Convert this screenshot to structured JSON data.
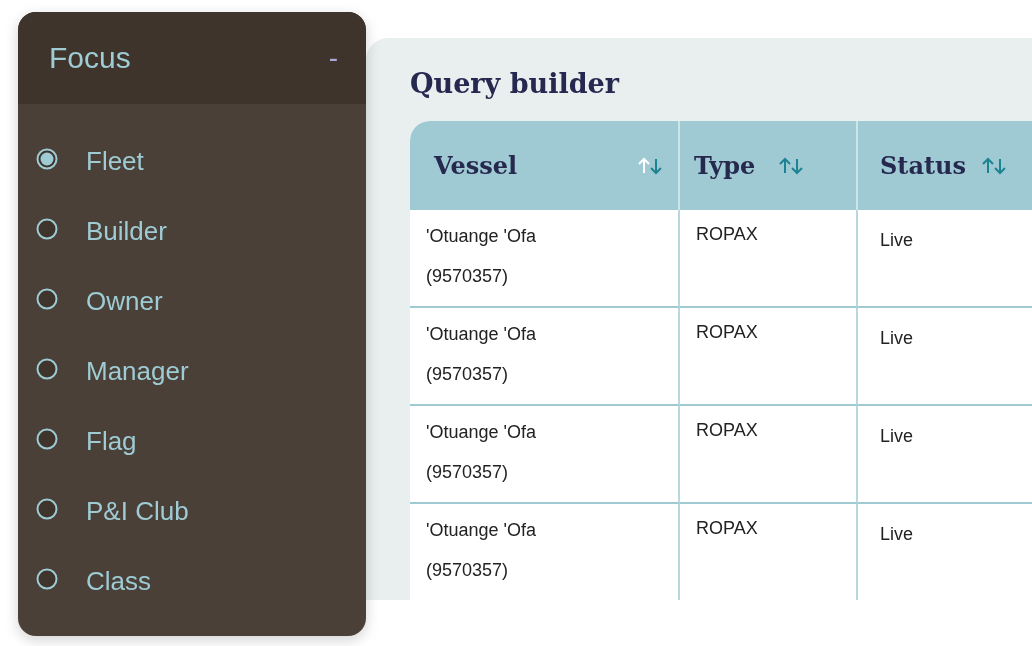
{
  "focus_panel": {
    "title": "Focus",
    "collapse_label": "-",
    "expanded": true,
    "options": [
      {
        "label": "Fleet",
        "selected": true
      },
      {
        "label": "Builder",
        "selected": false
      },
      {
        "label": "Owner",
        "selected": false
      },
      {
        "label": "Manager",
        "selected": false
      },
      {
        "label": "Flag",
        "selected": false
      },
      {
        "label": "P&I Club",
        "selected": false
      },
      {
        "label": "Class",
        "selected": false
      }
    ]
  },
  "query_builder": {
    "title": "Query builder",
    "table": {
      "columns": [
        {
          "label": "Vessel",
          "sorted_ascending": true
        },
        {
          "label": "Type",
          "sorted_ascending": false
        },
        {
          "label": "Status",
          "sorted_ascending": false
        }
      ],
      "rows": [
        {
          "vessel": "'Otuange 'Ofa",
          "imo": "(9570357)",
          "type": "ROPAX",
          "status": "Live"
        },
        {
          "vessel": "'Otuange 'Ofa",
          "imo": "(9570357)",
          "type": "ROPAX",
          "status": "Live"
        },
        {
          "vessel": "'Otuange 'Ofa",
          "imo": "(9570357)",
          "type": "ROPAX",
          "status": "Live"
        },
        {
          "vessel": "'Otuange 'Ofa",
          "imo": "(9570357)",
          "type": "ROPAX",
          "status": "Live"
        }
      ]
    }
  }
}
